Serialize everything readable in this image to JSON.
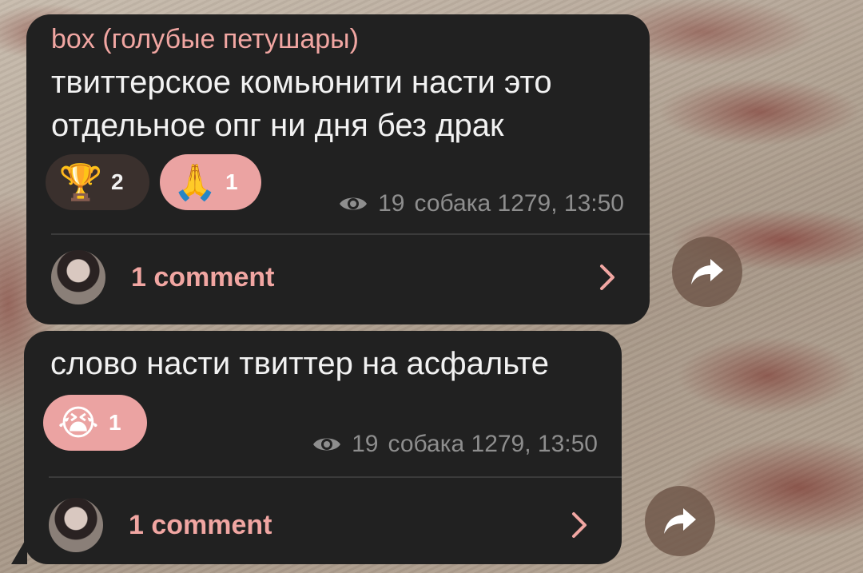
{
  "messages": [
    {
      "sender": "box (голубые петушары)",
      "text": "твиттерское комьюнити насти это отдельное опг ни дня без драк",
      "reactions": [
        {
          "emoji": "🏆",
          "count": "2",
          "icon": "trophy-icon"
        },
        {
          "emoji": "🙏",
          "count": "1",
          "icon": "folded-hands-icon"
        }
      ],
      "views": "19",
      "author_time": "собака 1279, 13:50",
      "comments_label": "1 comment"
    },
    {
      "text": "слово насти твиттер на асфальте",
      "reactions": [
        {
          "emoji": "😭",
          "count": "1",
          "icon": "loudly-crying-face-icon"
        }
      ],
      "views": "19",
      "author_time": "собака 1279, 13:50",
      "comments_label": "1 comment"
    }
  ],
  "colors": {
    "bubble": "#212121",
    "accent": "#f1a6a2",
    "reaction_active": "#eba3a2",
    "meta": "#8e8e8e"
  }
}
